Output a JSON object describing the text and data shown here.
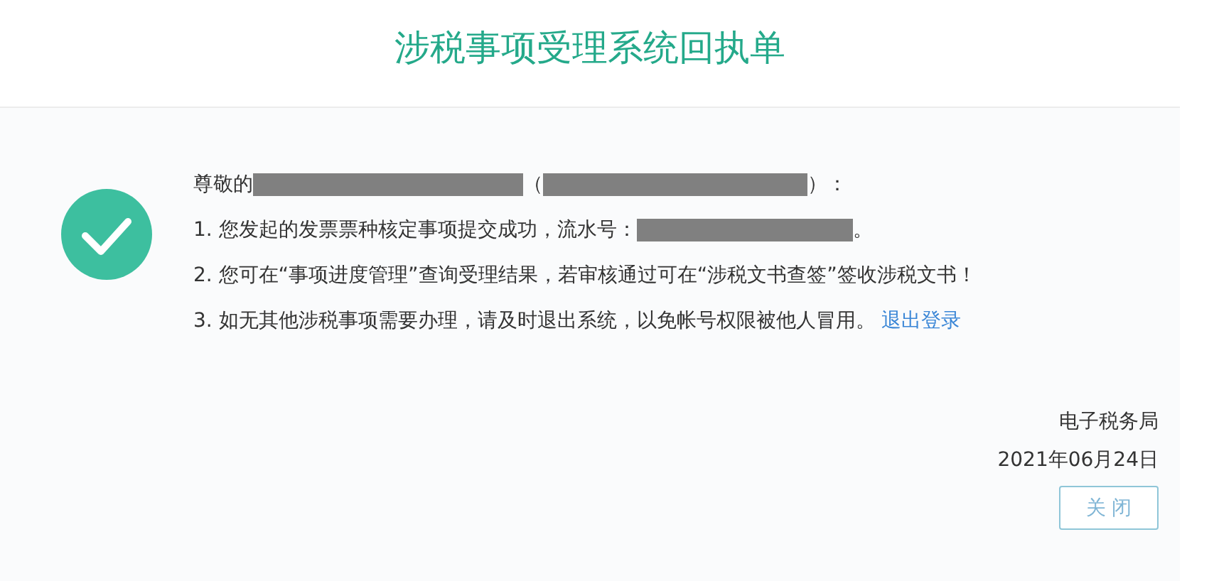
{
  "title": "涉税事项受理系统回执单",
  "lines": [
    [
      {
        "kind": "text",
        "text": "尊敬的"
      },
      {
        "kind": "redaction"
      },
      {
        "kind": "text",
        "text": "（"
      },
      {
        "kind": "redaction"
      },
      {
        "kind": "text",
        "text": "）："
      }
    ],
    [
      {
        "kind": "text",
        "text": "1. 您发起的发票票种核定事项提交成功，流水号："
      },
      {
        "kind": "redaction"
      },
      {
        "kind": "text",
        "text": "。"
      }
    ],
    [
      {
        "kind": "text",
        "text": "2. 您可在“事项进度管理”查询受理结果，若审核通过可在“涉税文书查签”签收涉税文书！"
      }
    ],
    [
      {
        "kind": "text",
        "text": "3. 如无其他涉税事项需要办理，请及时退出系统，以免帐号权限被他人冒用。"
      },
      {
        "kind": "link",
        "text": "退出登录"
      }
    ]
  ],
  "issuer": "电子税务局",
  "date": "2021年06月24日",
  "close_button": "关 闭"
}
